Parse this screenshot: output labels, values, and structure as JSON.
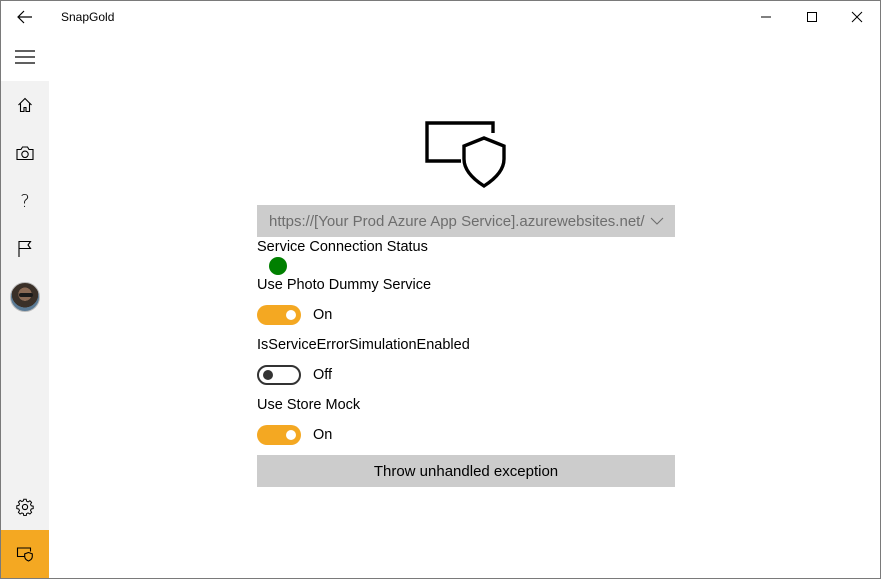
{
  "window": {
    "title": "SnapGold",
    "controls": [
      "minimize-icon",
      "maximize-icon",
      "close-icon"
    ]
  },
  "sidebar": {
    "items": [
      {
        "id": "hamburger",
        "icon": "hamburger-menu-icon"
      },
      {
        "id": "home",
        "icon": "home-icon"
      },
      {
        "id": "camera",
        "icon": "camera-icon"
      },
      {
        "id": "help",
        "icon": "question-mark-icon",
        "glyph": "?"
      },
      {
        "id": "flag",
        "icon": "flag-icon"
      },
      {
        "id": "profile",
        "icon": "avatar"
      },
      {
        "id": "settings",
        "icon": "gear-icon"
      },
      {
        "id": "dev",
        "icon": "screen-shield-icon",
        "selected": true
      }
    ]
  },
  "main": {
    "endpoint": {
      "selected": "https://[Your Prod Azure App Service].azurewebsites.net/"
    },
    "service_status": {
      "label": "Service Connection Status",
      "status_color": "#008000"
    },
    "photo_dummy": {
      "label": "Use Photo Dummy Service",
      "state": "On",
      "enabled": true
    },
    "error_simulation": {
      "label": "IsServiceErrorSimulationEnabled",
      "state": "Off",
      "enabled": false
    },
    "store_mock": {
      "label": "Use Store Mock",
      "state": "On",
      "enabled": true
    },
    "throw_button": {
      "label": "Throw unhandled exception"
    }
  },
  "colors": {
    "accent": "#f4a822",
    "status_ok": "#008000",
    "control_bg": "#cccccc"
  }
}
